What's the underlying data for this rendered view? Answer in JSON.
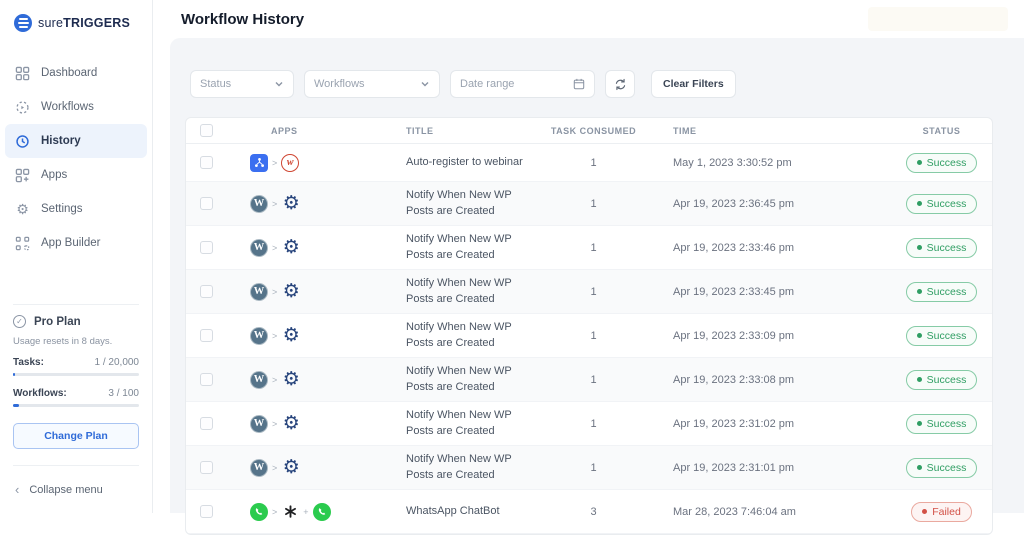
{
  "app": {
    "brand_part1": "sure",
    "brand_part2": "TRIGGERS"
  },
  "sidebar": {
    "items": [
      {
        "label": "Dashboard",
        "icon": "dashboard-icon",
        "active": false
      },
      {
        "label": "Workflows",
        "icon": "workflows-icon",
        "active": false
      },
      {
        "label": "History",
        "icon": "history-icon",
        "active": true
      },
      {
        "label": "Apps",
        "icon": "apps-icon",
        "active": false
      },
      {
        "label": "Settings",
        "icon": "settings-icon",
        "active": false
      },
      {
        "label": "App Builder",
        "icon": "app-builder-icon",
        "active": false
      }
    ],
    "plan": {
      "name": "Pro Plan",
      "usage_note": "Usage resets in 8 days.",
      "tasks_label": "Tasks:",
      "tasks_value": "1 / 20,000",
      "workflows_label": "Workflows:",
      "workflows_value": "3 / 100",
      "change_plan_label": "Change Plan"
    },
    "collapse_label": "Collapse menu"
  },
  "header": {
    "title": "Workflow History"
  },
  "filters": {
    "status_placeholder": "Status",
    "workflows_placeholder": "Workflows",
    "date_range_placeholder": "Date range",
    "clear_button": "Clear Filters"
  },
  "table": {
    "headers": {
      "apps": "APPS",
      "title": "TITLE",
      "tasks": "TASK CONSUMED",
      "time": "TIME",
      "status": "STATUS"
    },
    "rows": [
      {
        "apps": [
          "suretriggers",
          ">",
          "webinarjam"
        ],
        "title": "Auto-register to webinar",
        "tasks": "1",
        "time": "May 1, 2023 3:30:52 pm",
        "status": "Success"
      },
      {
        "apps": [
          "wordpress",
          ">",
          "gear"
        ],
        "title": "Notify When New WP Posts are Created",
        "tasks": "1",
        "time": "Apr 19, 2023 2:36:45 pm",
        "status": "Success"
      },
      {
        "apps": [
          "wordpress",
          ">",
          "gear"
        ],
        "title": "Notify When New WP Posts are Created",
        "tasks": "1",
        "time": "Apr 19, 2023 2:33:46 pm",
        "status": "Success"
      },
      {
        "apps": [
          "wordpress",
          ">",
          "gear"
        ],
        "title": "Notify When New WP Posts are Created",
        "tasks": "1",
        "time": "Apr 19, 2023 2:33:45 pm",
        "status": "Success"
      },
      {
        "apps": [
          "wordpress",
          ">",
          "gear"
        ],
        "title": "Notify When New WP Posts are Created",
        "tasks": "1",
        "time": "Apr 19, 2023 2:33:09 pm",
        "status": "Success"
      },
      {
        "apps": [
          "wordpress",
          ">",
          "gear"
        ],
        "title": "Notify When New WP Posts are Created",
        "tasks": "1",
        "time": "Apr 19, 2023 2:33:08 pm",
        "status": "Success"
      },
      {
        "apps": [
          "wordpress",
          ">",
          "gear"
        ],
        "title": "Notify When New WP Posts are Created",
        "tasks": "1",
        "time": "Apr 19, 2023 2:31:02 pm",
        "status": "Success"
      },
      {
        "apps": [
          "wordpress",
          ">",
          "gear"
        ],
        "title": "Notify When New WP Posts are Created",
        "tasks": "1",
        "time": "Apr 19, 2023 2:31:01 pm",
        "status": "Success"
      },
      {
        "apps": [
          "whatsapp",
          ">",
          "openai",
          "+",
          "whatsapp"
        ],
        "title": "WhatsApp ChatBot",
        "tasks": "3",
        "time": "Mar 28, 2023 7:46:04 am",
        "status": "Failed"
      }
    ]
  },
  "colors": {
    "accent_blue": "#2f6bd8",
    "success_green": "#2f9e63",
    "failed_red": "#d25046",
    "panel_bg": "#f3f5f8"
  }
}
